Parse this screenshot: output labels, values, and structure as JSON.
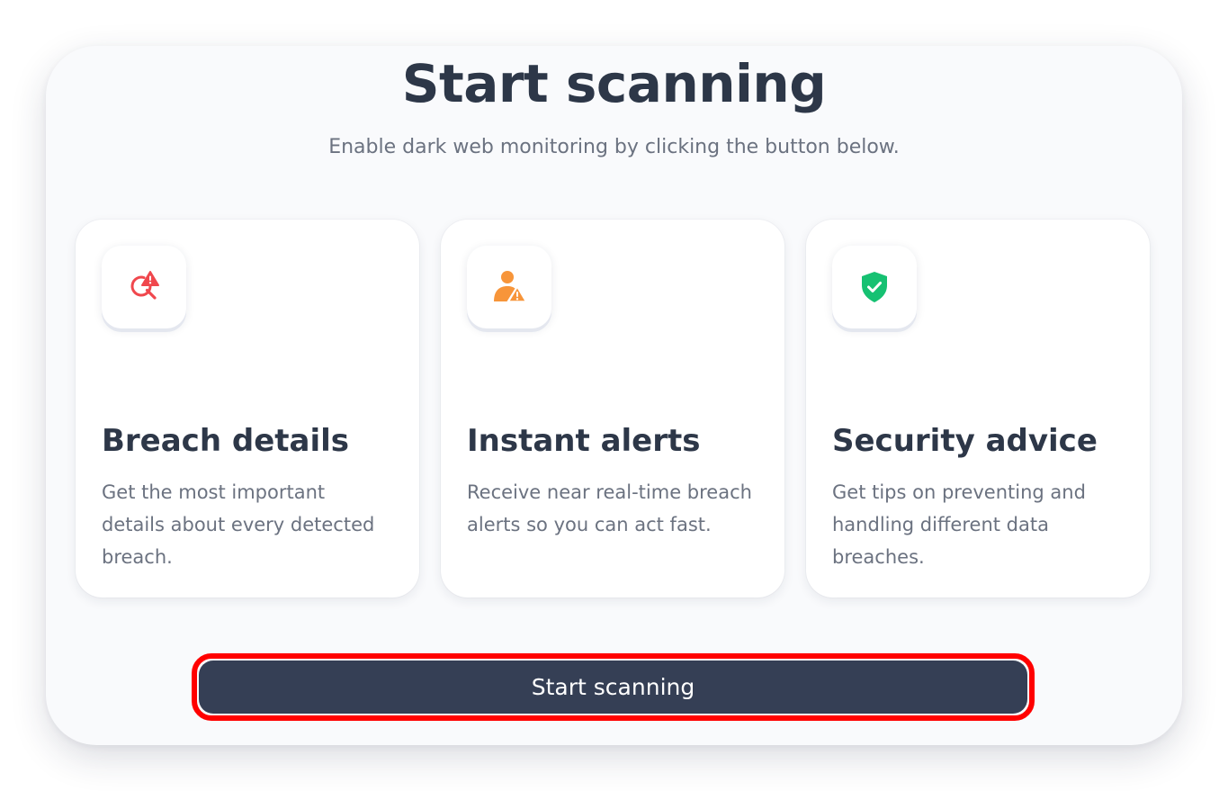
{
  "header": {
    "title": "Start scanning",
    "subtitle": "Enable dark web monitoring by clicking the button below."
  },
  "features": [
    {
      "icon": "search-alert-icon",
      "icon_color": "#f0474d",
      "title": "Breach details",
      "description": "Get the most important details about every detected breach."
    },
    {
      "icon": "user-alert-icon",
      "icon_color": "#f7953a",
      "title": "Instant alerts",
      "description": "Receive near real-time breach alerts so you can act fast."
    },
    {
      "icon": "shield-check-icon",
      "icon_color": "#16c172",
      "title": "Security advice",
      "description": "Get tips on preventing and handling different data breaches."
    }
  ],
  "cta": {
    "label": "Start scanning",
    "background": "#353f55",
    "highlight_color": "#ff0000"
  }
}
